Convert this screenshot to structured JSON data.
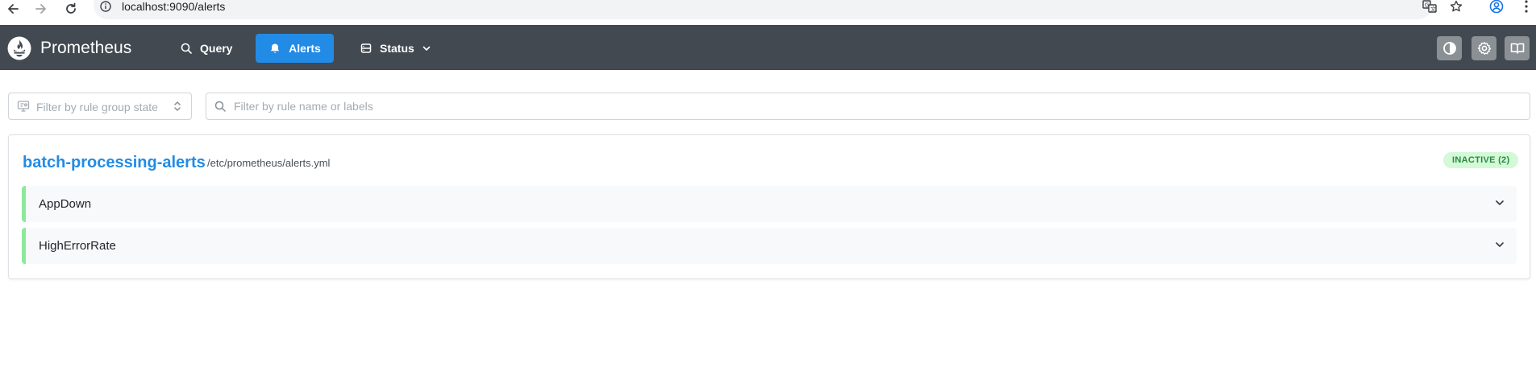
{
  "browser": {
    "url": "localhost:9090/alerts"
  },
  "app": {
    "brand": "Prometheus",
    "nav": {
      "query": "Query",
      "alerts": "Alerts",
      "status": "Status"
    },
    "accent_color": "#228be6",
    "navbar_color": "#424950"
  },
  "filters": {
    "state_placeholder": "Filter by rule group state",
    "search_placeholder": "Filter by rule name or labels"
  },
  "rule_group": {
    "name": "batch-processing-alerts",
    "file": "/etc/prometheus/alerts.yml",
    "state_badge": "INACTIVE (2)",
    "badge_color": "#2b8a3e",
    "rules": [
      {
        "name": "AppDown"
      },
      {
        "name": "HighErrorRate"
      }
    ]
  }
}
